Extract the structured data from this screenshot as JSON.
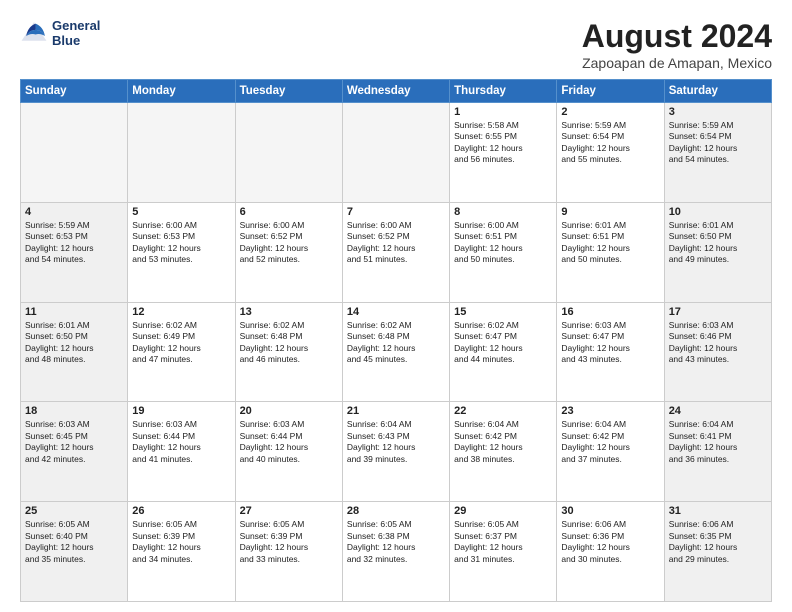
{
  "header": {
    "logo_line1": "General",
    "logo_line2": "Blue",
    "main_title": "August 2024",
    "subtitle": "Zapoapan de Amapan, Mexico"
  },
  "days_of_week": [
    "Sunday",
    "Monday",
    "Tuesday",
    "Wednesday",
    "Thursday",
    "Friday",
    "Saturday"
  ],
  "weeks": [
    [
      {
        "day": "",
        "info": "",
        "empty": true
      },
      {
        "day": "",
        "info": "",
        "empty": true
      },
      {
        "day": "",
        "info": "",
        "empty": true
      },
      {
        "day": "",
        "info": "",
        "empty": true
      },
      {
        "day": "1",
        "info": "Sunrise: 5:58 AM\nSunset: 6:55 PM\nDaylight: 12 hours\nand 56 minutes."
      },
      {
        "day": "2",
        "info": "Sunrise: 5:59 AM\nSunset: 6:54 PM\nDaylight: 12 hours\nand 55 minutes."
      },
      {
        "day": "3",
        "info": "Sunrise: 5:59 AM\nSunset: 6:54 PM\nDaylight: 12 hours\nand 54 minutes."
      }
    ],
    [
      {
        "day": "4",
        "info": "Sunrise: 5:59 AM\nSunset: 6:53 PM\nDaylight: 12 hours\nand 54 minutes."
      },
      {
        "day": "5",
        "info": "Sunrise: 6:00 AM\nSunset: 6:53 PM\nDaylight: 12 hours\nand 53 minutes."
      },
      {
        "day": "6",
        "info": "Sunrise: 6:00 AM\nSunset: 6:52 PM\nDaylight: 12 hours\nand 52 minutes."
      },
      {
        "day": "7",
        "info": "Sunrise: 6:00 AM\nSunset: 6:52 PM\nDaylight: 12 hours\nand 51 minutes."
      },
      {
        "day": "8",
        "info": "Sunrise: 6:00 AM\nSunset: 6:51 PM\nDaylight: 12 hours\nand 50 minutes."
      },
      {
        "day": "9",
        "info": "Sunrise: 6:01 AM\nSunset: 6:51 PM\nDaylight: 12 hours\nand 50 minutes."
      },
      {
        "day": "10",
        "info": "Sunrise: 6:01 AM\nSunset: 6:50 PM\nDaylight: 12 hours\nand 49 minutes."
      }
    ],
    [
      {
        "day": "11",
        "info": "Sunrise: 6:01 AM\nSunset: 6:50 PM\nDaylight: 12 hours\nand 48 minutes."
      },
      {
        "day": "12",
        "info": "Sunrise: 6:02 AM\nSunset: 6:49 PM\nDaylight: 12 hours\nand 47 minutes."
      },
      {
        "day": "13",
        "info": "Sunrise: 6:02 AM\nSunset: 6:48 PM\nDaylight: 12 hours\nand 46 minutes."
      },
      {
        "day": "14",
        "info": "Sunrise: 6:02 AM\nSunset: 6:48 PM\nDaylight: 12 hours\nand 45 minutes."
      },
      {
        "day": "15",
        "info": "Sunrise: 6:02 AM\nSunset: 6:47 PM\nDaylight: 12 hours\nand 44 minutes."
      },
      {
        "day": "16",
        "info": "Sunrise: 6:03 AM\nSunset: 6:47 PM\nDaylight: 12 hours\nand 43 minutes."
      },
      {
        "day": "17",
        "info": "Sunrise: 6:03 AM\nSunset: 6:46 PM\nDaylight: 12 hours\nand 43 minutes."
      }
    ],
    [
      {
        "day": "18",
        "info": "Sunrise: 6:03 AM\nSunset: 6:45 PM\nDaylight: 12 hours\nand 42 minutes."
      },
      {
        "day": "19",
        "info": "Sunrise: 6:03 AM\nSunset: 6:44 PM\nDaylight: 12 hours\nand 41 minutes."
      },
      {
        "day": "20",
        "info": "Sunrise: 6:03 AM\nSunset: 6:44 PM\nDaylight: 12 hours\nand 40 minutes."
      },
      {
        "day": "21",
        "info": "Sunrise: 6:04 AM\nSunset: 6:43 PM\nDaylight: 12 hours\nand 39 minutes."
      },
      {
        "day": "22",
        "info": "Sunrise: 6:04 AM\nSunset: 6:42 PM\nDaylight: 12 hours\nand 38 minutes."
      },
      {
        "day": "23",
        "info": "Sunrise: 6:04 AM\nSunset: 6:42 PM\nDaylight: 12 hours\nand 37 minutes."
      },
      {
        "day": "24",
        "info": "Sunrise: 6:04 AM\nSunset: 6:41 PM\nDaylight: 12 hours\nand 36 minutes."
      }
    ],
    [
      {
        "day": "25",
        "info": "Sunrise: 6:05 AM\nSunset: 6:40 PM\nDaylight: 12 hours\nand 35 minutes."
      },
      {
        "day": "26",
        "info": "Sunrise: 6:05 AM\nSunset: 6:39 PM\nDaylight: 12 hours\nand 34 minutes."
      },
      {
        "day": "27",
        "info": "Sunrise: 6:05 AM\nSunset: 6:39 PM\nDaylight: 12 hours\nand 33 minutes."
      },
      {
        "day": "28",
        "info": "Sunrise: 6:05 AM\nSunset: 6:38 PM\nDaylight: 12 hours\nand 32 minutes."
      },
      {
        "day": "29",
        "info": "Sunrise: 6:05 AM\nSunset: 6:37 PM\nDaylight: 12 hours\nand 31 minutes."
      },
      {
        "day": "30",
        "info": "Sunrise: 6:06 AM\nSunset: 6:36 PM\nDaylight: 12 hours\nand 30 minutes."
      },
      {
        "day": "31",
        "info": "Sunrise: 6:06 AM\nSunset: 6:35 PM\nDaylight: 12 hours\nand 29 minutes."
      }
    ]
  ]
}
